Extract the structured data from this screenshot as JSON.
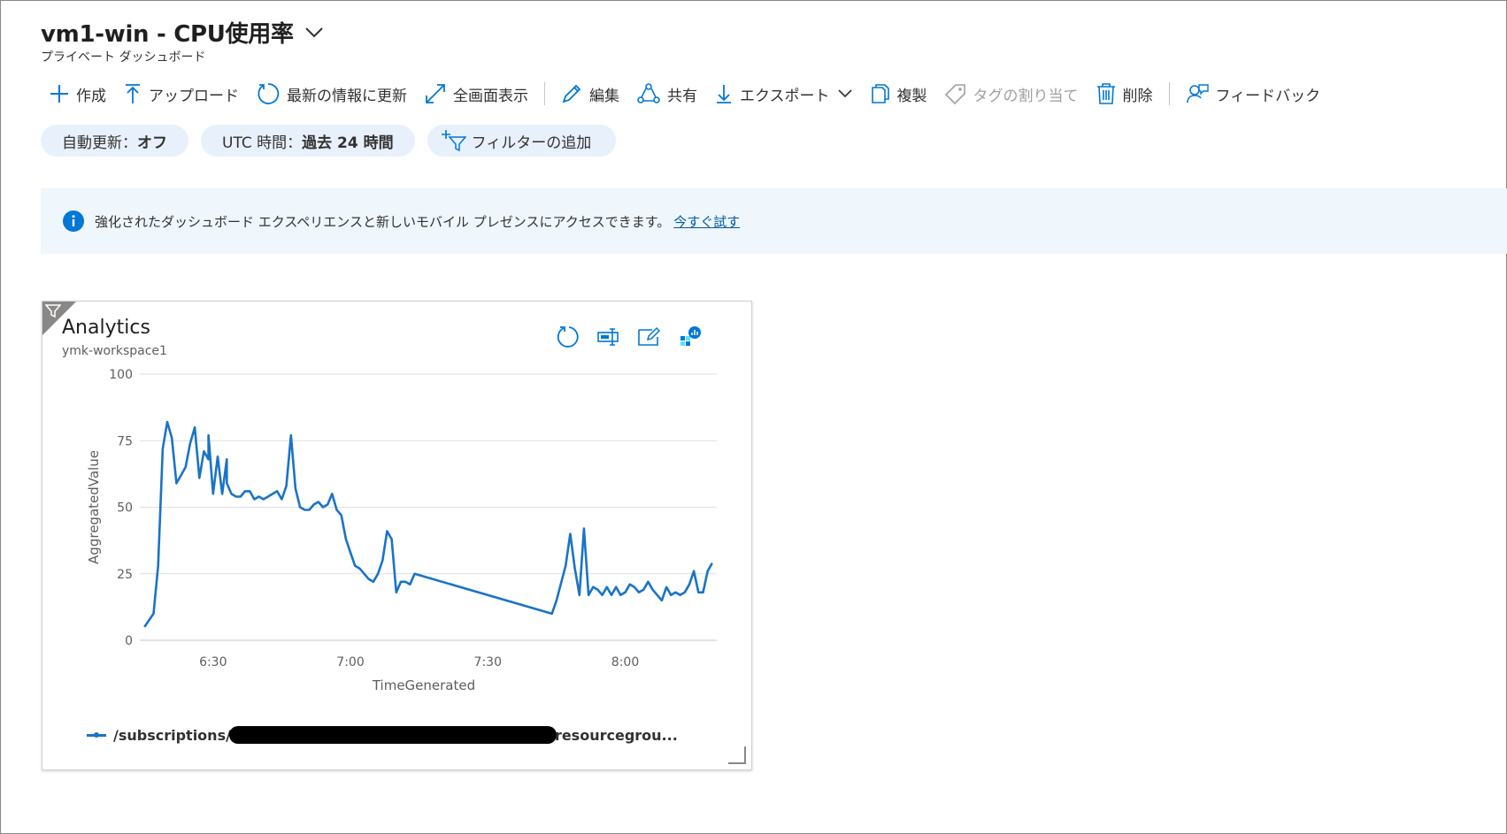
{
  "header": {
    "title": "vm1-win - CPU使用率",
    "subtitle": "プライベート ダッシュボード"
  },
  "toolbar": {
    "create": "作成",
    "upload": "アップロード",
    "refresh": "最新の情報に更新",
    "fullscreen": "全画面表示",
    "edit": "編集",
    "share": "共有",
    "export": "エクスポート",
    "clone": "複製",
    "assign_tags": "タグの割り当て",
    "delete": "削除",
    "feedback": "フィードバック"
  },
  "filters": {
    "auto_refresh_label": "自動更新：",
    "auto_refresh_value": "オフ",
    "time_label": "UTC 時間：",
    "time_value": "過去 24 時間",
    "add_filter": "フィルターの追加"
  },
  "banner": {
    "message": "強化されたダッシュボード エクスペリエンスと新しいモバイル プレゼンスにアクセスできます。",
    "link": "今すぐ試す"
  },
  "tile": {
    "title": "Analytics",
    "subtitle": "ymk-workspace1",
    "legend_prefix": "/subscriptions/",
    "legend_suffix": "resourcegrou..."
  },
  "colors": {
    "accent": "#0078d4",
    "series": "#1a73c7",
    "pill_bg": "#e8f0fb",
    "banner_bg": "#eff6fc"
  },
  "chart_data": {
    "type": "line",
    "xlabel": "TimeGenerated",
    "ylabel": "AggregatedValue",
    "ylim": [
      0,
      100
    ],
    "yticks": [
      0,
      25,
      50,
      75,
      100
    ],
    "xticks": [
      "6:30",
      "7:00",
      "7:30",
      "8:00"
    ],
    "xlim_minutes": [
      "6:14",
      "8:20"
    ],
    "grid": true,
    "series": [
      {
        "name": "/subscriptions/…/resourcegrou...",
        "x": [
          "6:15",
          "6:17",
          "6:18",
          "6:19",
          "6:20",
          "6:21",
          "6:22",
          "6:23",
          "6:24",
          "6:25",
          "6:26",
          "6:27",
          "6:28",
          "6:29",
          "6:29",
          "6:30",
          "6:31",
          "6:32",
          "6:33",
          "6:33",
          "6:34",
          "6:35",
          "6:36",
          "6:37",
          "6:38",
          "6:39",
          "6:40",
          "6:41",
          "6:42",
          "6:43",
          "6:44",
          "6:45",
          "6:46",
          "6:47",
          "6:48",
          "6:49",
          "6:50",
          "6:51",
          "6:52",
          "6:53",
          "6:54",
          "6:55",
          "6:56",
          "6:57",
          "6:58",
          "6:59",
          "7:00",
          "7:01",
          "7:02",
          "7:03",
          "7:04",
          "7:05",
          "7:06",
          "7:07",
          "7:08",
          "7:09",
          "7:10",
          "7:11",
          "7:12",
          "7:13",
          "7:14",
          "7:44",
          "7:45",
          "7:47",
          "7:48",
          "7:49",
          "7:50",
          "7:51",
          "7:52",
          "7:53",
          "7:54",
          "7:55",
          "7:56",
          "7:57",
          "7:58",
          "7:59",
          "8:00",
          "8:01",
          "8:02",
          "8:03",
          "8:04",
          "8:05",
          "8:06",
          "8:07",
          "8:08",
          "8:09",
          "8:10",
          "8:11",
          "8:12",
          "8:13",
          "8:14",
          "8:15",
          "8:16",
          "8:17",
          "8:18",
          "8:19"
        ],
        "values": [
          5,
          10,
          28,
          72,
          82,
          76,
          59,
          62,
          65,
          74,
          80,
          61,
          71,
          68,
          77,
          55,
          69,
          55,
          68,
          59,
          55,
          54,
          54,
          56,
          56,
          53,
          54,
          53,
          54,
          55,
          56,
          53,
          58,
          77,
          57,
          50,
          49,
          49,
          51,
          52,
          50,
          51,
          55,
          49,
          47,
          38,
          33,
          28,
          27,
          25,
          23,
          22,
          25,
          30,
          41,
          38,
          18,
          22,
          22,
          21,
          25,
          10,
          15,
          28,
          40,
          27,
          17,
          42,
          17,
          20,
          19,
          17,
          20,
          17,
          20,
          17,
          18,
          21,
          20,
          18,
          19,
          22,
          19,
          17,
          15,
          20,
          17,
          18,
          17,
          18,
          21,
          26,
          18,
          18,
          26,
          29
        ]
      }
    ]
  }
}
